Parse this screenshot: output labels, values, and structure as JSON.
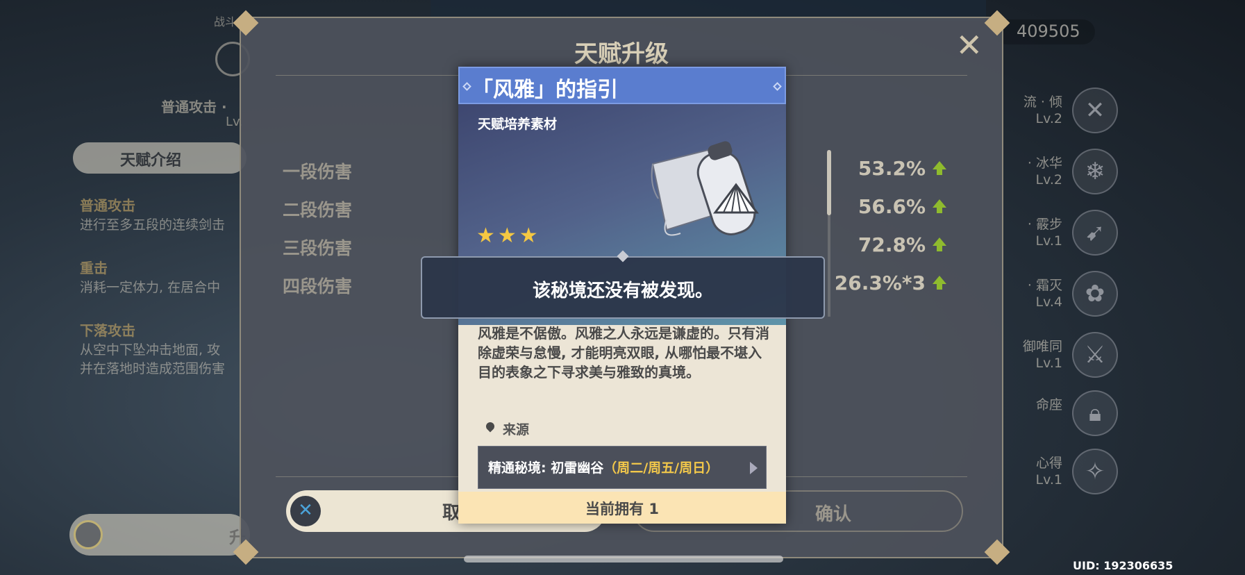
{
  "background": {
    "left_panel": {
      "section_title": "战斗",
      "attack_name": "普通攻击 ·",
      "attack_level": "Lv.",
      "tab_label": "天赋介绍",
      "descriptions": [
        {
          "heading": "普通攻击",
          "text": "进行至多五段的连续剑击"
        },
        {
          "heading": "重击",
          "text": "消耗一定体力, 在居合中"
        },
        {
          "heading": "下落攻击",
          "text": "从空中下坠冲击地面, 攻",
          "text2": "并在落地时造成范围伤害"
        }
      ],
      "bottom_button_label": "升"
    },
    "right_panel": {
      "mora": "409505",
      "talents": [
        {
          "name": "流 · 倾",
          "level": "Lv.2",
          "icon": "sword-cross-icon"
        },
        {
          "name": "· 冰华",
          "level": "Lv.2",
          "icon": "snowflake-icon"
        },
        {
          "name": "· 霰步",
          "level": "Lv.1",
          "icon": "dash-icon"
        },
        {
          "name": "· 霜灭",
          "level": "Lv.4",
          "icon": "flower-icon"
        },
        {
          "name": "御唯同",
          "level": "Lv.1",
          "icon": "blade-icon"
        },
        {
          "name": "命座",
          "level": "",
          "icon": "lock-icon"
        },
        {
          "name": "心得",
          "level": "Lv.1",
          "icon": "charm-icon"
        }
      ]
    },
    "uid": "UID: 192306635"
  },
  "dialog": {
    "title": "天赋升级",
    "close_icon": "close-icon",
    "stats": [
      {
        "label": "一段伤害",
        "value": "53.2%"
      },
      {
        "label": "二段伤害",
        "value": "56.6%"
      },
      {
        "label": "三段伤害",
        "value": "72.8%"
      },
      {
        "label": "四段伤害",
        "value": "26.3%*3"
      }
    ],
    "cancel_label": "取",
    "confirm_label": "确认"
  },
  "item_card": {
    "title": "「风雅」的指引",
    "type": "天赋培养素材",
    "rarity_stars": 3,
    "stars_text": "★★★",
    "description": "风雅是不倨傲。风雅之人永远是谦虚的。只有消除虚荣与怠慢, 才能明亮双眼, 从哪怕最不堪入目的表象之下寻求美与雅致的真境。",
    "source_label": "来源",
    "source_name": "精通秘境: 初雷幽谷",
    "source_days": "（周二/周五/周日）",
    "owned_text": "当前拥有 1",
    "colors": {
      "header": "#5a7dcf",
      "stars": "#f5c842",
      "days": "#f3c84a"
    }
  },
  "toast": {
    "message": "该秘境还没有被发现。"
  }
}
